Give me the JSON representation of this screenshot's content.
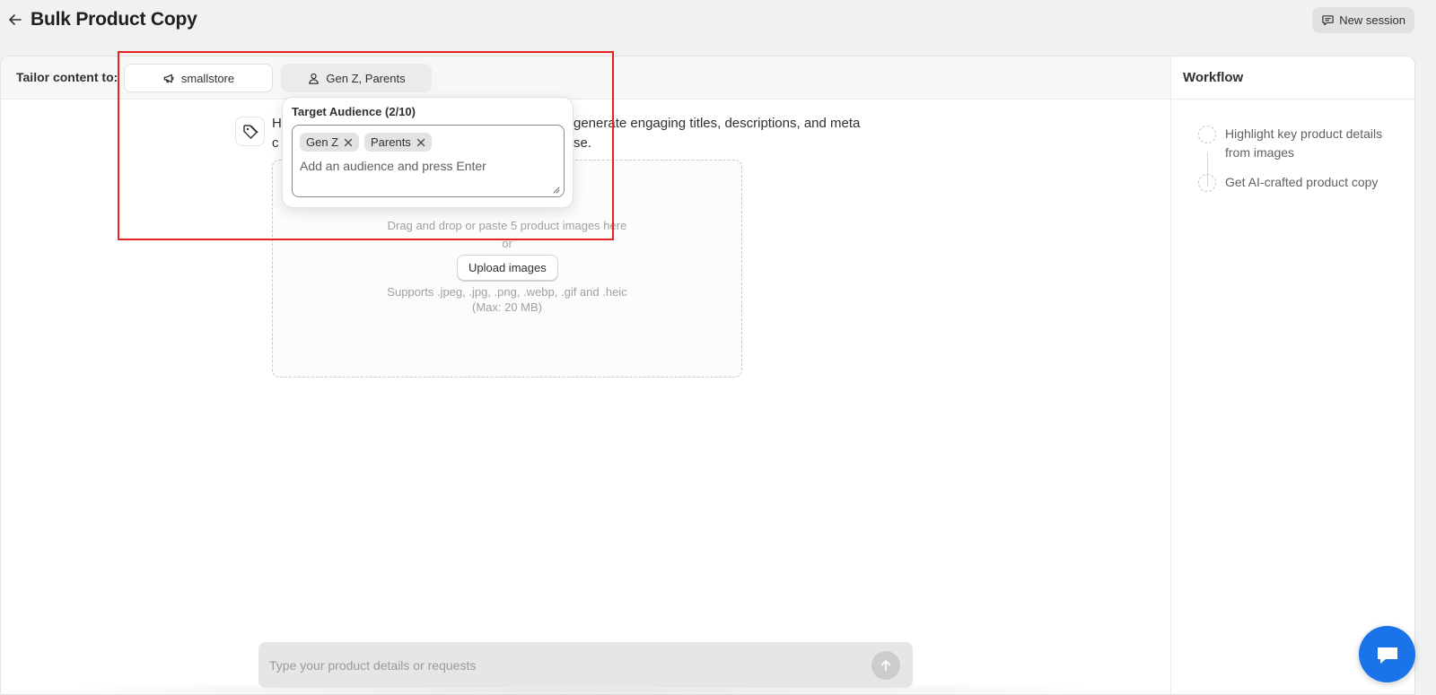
{
  "header": {
    "title": "Bulk Product Copy",
    "new_session_label": "New session"
  },
  "tailor": {
    "label": "Tailor content to:",
    "store_chip": "smallstore",
    "audience_chip": "Gen Z, Parents"
  },
  "intro": {
    "line1_start": "H",
    "line1_end": "generate engaging titles, descriptions, and meta",
    "line2_start": "c",
    "line2_end": "se."
  },
  "dropzone": {
    "hint": "Drag and drop or paste 5 product images here",
    "or": "or",
    "upload_label": "Upload images",
    "supports": "Supports .jpeg, .jpg, .png, .webp, .gif and .heic",
    "max_size": "(Max: 20 MB)"
  },
  "audience_popover": {
    "title": "Target Audience (2/10)",
    "tags": [
      "Gen Z",
      "Parents"
    ],
    "input_placeholder": "Add an audience and press Enter"
  },
  "workflow": {
    "title": "Workflow",
    "steps": [
      "Highlight key product details from images",
      "Get AI-crafted product copy"
    ]
  },
  "composer": {
    "placeholder": "Type your product details or requests"
  },
  "colors": {
    "highlight_border": "#e8231f",
    "chat_bubble": "#1a73e8",
    "background": "#f1f1f1"
  },
  "icons": {
    "back": "arrow-left-icon",
    "new_session": "chat-icon",
    "store": "megaphone-icon",
    "audience": "person-icon",
    "bot": "tag-icon",
    "tag_remove": "close-icon",
    "send": "arrow-up-icon",
    "support_chat": "chat-bubble-icon"
  }
}
